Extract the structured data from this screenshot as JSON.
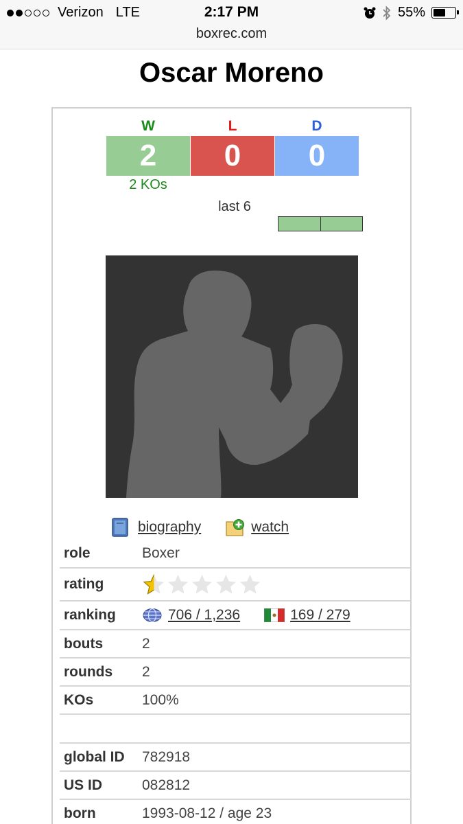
{
  "status_bar": {
    "carrier": "Verizon",
    "network": "LTE",
    "time": "2:17 PM",
    "battery": "55%",
    "battery_level": 0.55,
    "url": "boxrec.com"
  },
  "boxer": {
    "name": "Oscar Moreno"
  },
  "record": {
    "w_label": "W",
    "w_value": "2",
    "l_label": "L",
    "l_value": "0",
    "d_label": "D",
    "d_value": "0",
    "kos_text": "2 KOs",
    "last_label": "last 6",
    "colors": {
      "win": "#97cc95",
      "loss": "#d9534f",
      "draw": "#86b2f8"
    }
  },
  "links": {
    "biography": "biography",
    "watch": "watch"
  },
  "details": {
    "role": {
      "label": "role",
      "value": "Boxer"
    },
    "rating": {
      "label": "rating",
      "stars": 0.5,
      "max_stars": 5
    },
    "ranking": {
      "label": "ranking",
      "world": "706 / 1,236",
      "country": "169 / 279"
    },
    "bouts": {
      "label": "bouts",
      "value": "2"
    },
    "rounds": {
      "label": "rounds",
      "value": "2"
    },
    "kos": {
      "label": "KOs",
      "value": "100%"
    },
    "global_id": {
      "label": "global ID",
      "value": "782918"
    },
    "us_id": {
      "label": "US ID",
      "value": "082812"
    },
    "born": {
      "label": "born",
      "value": "1993-08-12 / age 23"
    }
  }
}
